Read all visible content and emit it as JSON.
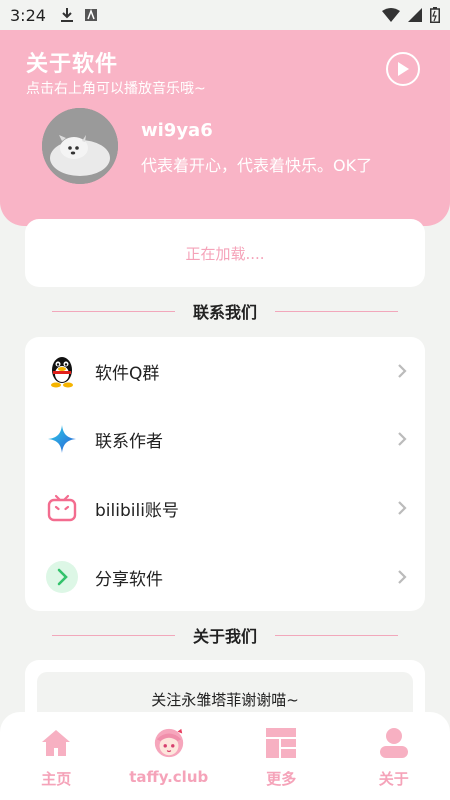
{
  "status": {
    "time": "3:24"
  },
  "header": {
    "title": "关于软件",
    "subtitle": "点击右上角可以播放音乐哦~",
    "username": "wi9ya6",
    "signature": "代表着开心，代表着快乐。OK了"
  },
  "loading": {
    "text": "正在加载...."
  },
  "contact_section": {
    "title": "联系我们",
    "items": [
      {
        "label": "软件Q群",
        "icon": "qq-penguin-icon"
      },
      {
        "label": "联系作者",
        "icon": "sparkle-icon"
      },
      {
        "label": "bilibili账号",
        "icon": "bilibili-tv-icon"
      },
      {
        "label": "分享软件",
        "icon": "share-chevron-icon"
      }
    ]
  },
  "about_section": {
    "title": "关于我们",
    "text": "关注永雏塔菲谢谢喵~"
  },
  "nav": {
    "items": [
      {
        "label": "主页",
        "icon": "home-icon"
      },
      {
        "label": "taffy.club",
        "icon": "taffy-avatar-icon"
      },
      {
        "label": "更多",
        "icon": "grid-icon"
      },
      {
        "label": "关于",
        "icon": "person-icon"
      }
    ]
  },
  "colors": {
    "accent": "#f9b4c6",
    "accent_text": "#f5a3b9",
    "background": "#f2f3f1"
  }
}
